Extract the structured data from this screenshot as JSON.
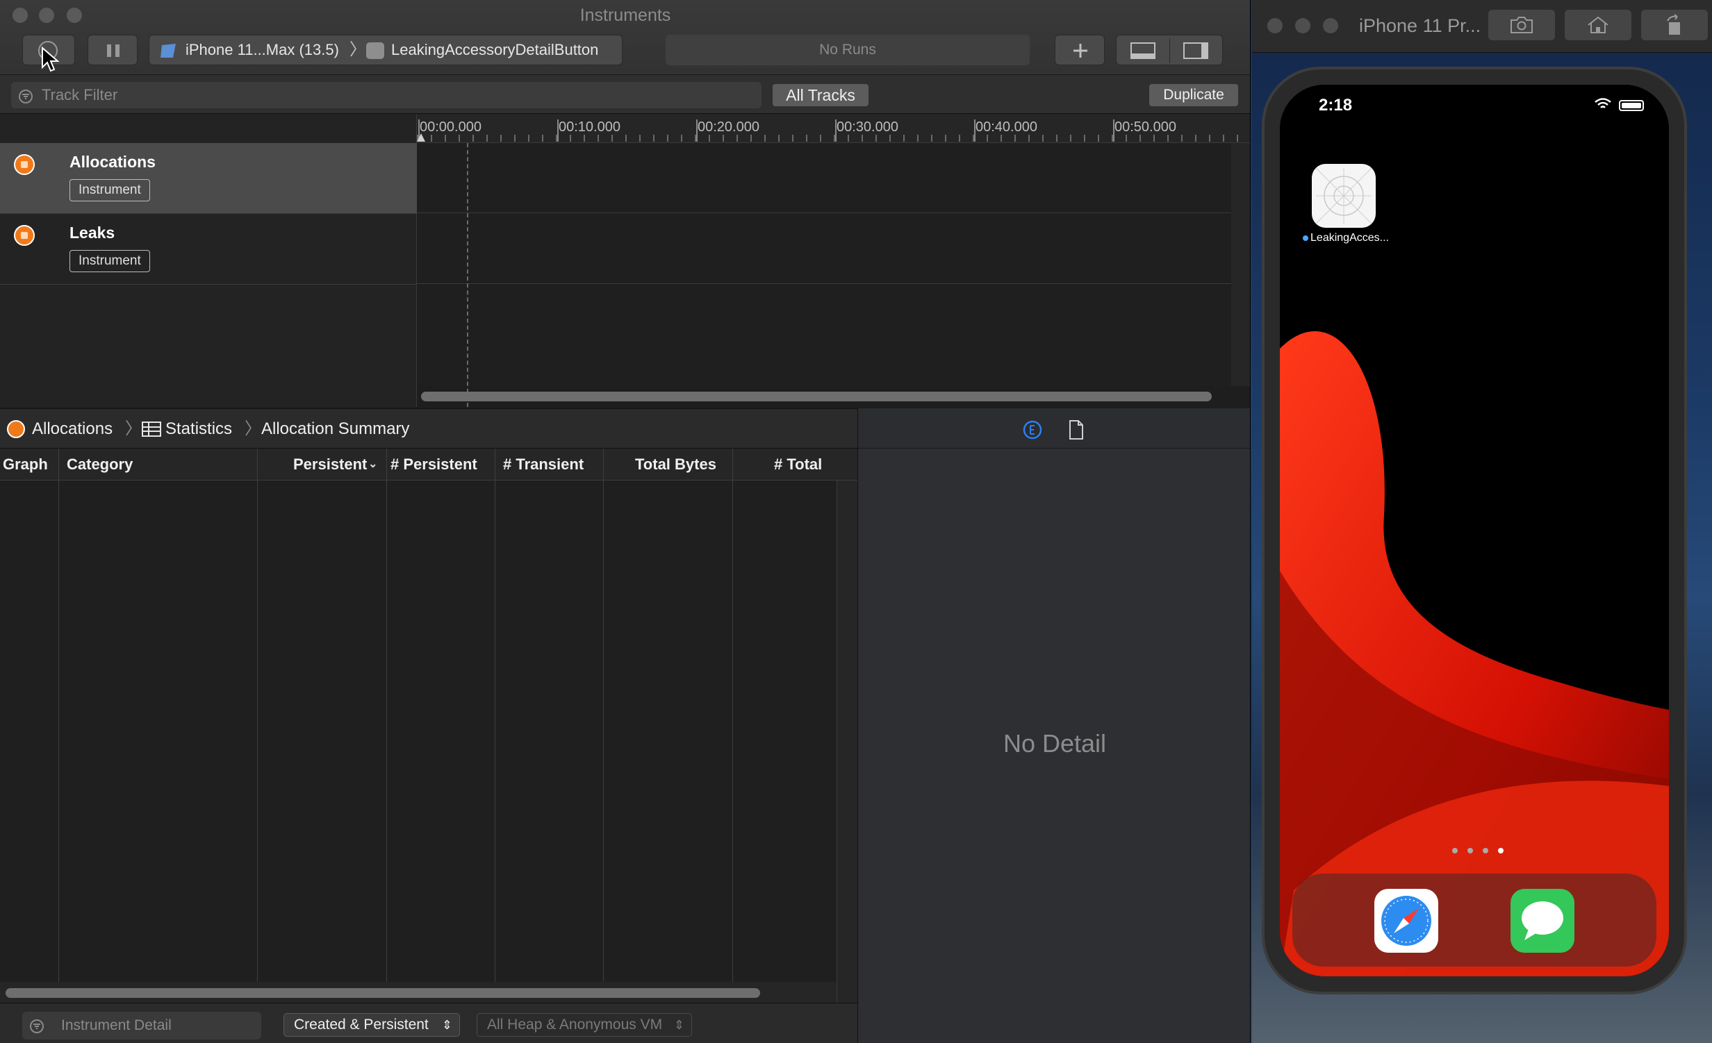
{
  "instruments": {
    "window_title": "Instruments",
    "device_label": "iPhone 11...Max (13.5)",
    "app_label": "LeakingAccessoryDetailButton",
    "runs_label": "No Runs",
    "track_filter_placeholder": "Track Filter",
    "all_tracks_label": "All Tracks",
    "duplicate_label": "Duplicate",
    "timeline_ticks": [
      "00:00.000",
      "00:10.000",
      "00:20.000",
      "00:30.000",
      "00:40.000",
      "00:50.000"
    ],
    "tracks": [
      {
        "name": "Allocations",
        "badge": "Instrument",
        "selected": true
      },
      {
        "name": "Leaks",
        "badge": "Instrument",
        "selected": false
      }
    ],
    "navbar": {
      "item1": "Allocations",
      "item2": "Statistics",
      "item3": "Allocation Summary"
    },
    "columns": [
      "Graph",
      "Category",
      "Persistent",
      "# Persistent",
      "# Transient",
      "Total Bytes",
      "# Total"
    ],
    "bottom": {
      "detail_placeholder": "Instrument Detail",
      "popup1": "Created & Persistent",
      "popup2": "All Heap & Anonymous VM"
    },
    "inspector": {
      "no_detail": "No Detail"
    }
  },
  "simulator": {
    "window_title": "iPhone 11 Pr...",
    "time": "2:18",
    "app_label": "LeakingAcces...",
    "page_count": 4,
    "current_page": 4,
    "dock_apps": [
      "safari-icon",
      "messages-icon"
    ]
  },
  "colors": {
    "accent_orange": "#f07a1a",
    "wallpaper_red": "#e01a06",
    "info_blue": "#2d7ff2"
  }
}
